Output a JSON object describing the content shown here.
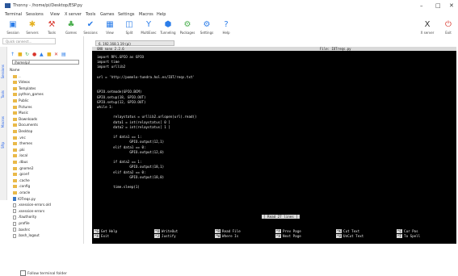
{
  "window": {
    "title": "Thonny - /home/pi/Desktop/ESP.py",
    "title_short": "Thonny"
  },
  "menu": [
    "Terminal",
    "Sessions",
    "View",
    "X server",
    "Tools",
    "Games",
    "Settings",
    "Macros",
    "Help"
  ],
  "toolbar": [
    "Session",
    "Servers",
    "Tools",
    "Games",
    "Sessions",
    "View",
    "Split",
    "MultiExec",
    "Tunneling",
    "Packages",
    "Settings",
    "Help"
  ],
  "toolbar_right": [
    "X server",
    "Exit"
  ],
  "left": {
    "search_placeholder": "Quick connect...",
    "vtabs": [
      "Sessions",
      "Tools",
      "Macros",
      "Sftp"
    ],
    "path": "/home/pi/",
    "tree": [
      {
        "label": "Name",
        "icon": "header"
      },
      {
        "label": "..",
        "icon": "folder"
      },
      {
        "label": "Videos",
        "icon": "folder"
      },
      {
        "label": "Templates",
        "icon": "folder"
      },
      {
        "label": "python_games",
        "icon": "folder"
      },
      {
        "label": "Public",
        "icon": "folder"
      },
      {
        "label": "Pictures",
        "icon": "folder"
      },
      {
        "label": "Music",
        "icon": "folder"
      },
      {
        "label": "Downloads",
        "icon": "folder"
      },
      {
        "label": "Documents",
        "icon": "folder"
      },
      {
        "label": "Desktop",
        "icon": "folder"
      },
      {
        "label": ".vnc",
        "icon": "folder"
      },
      {
        "label": ".themes",
        "icon": "folder"
      },
      {
        "label": ".pki",
        "icon": "folder"
      },
      {
        "label": ".local",
        "icon": "folder"
      },
      {
        "label": ".dbus",
        "icon": "folder"
      },
      {
        "label": ".gnome2",
        "icon": "folder"
      },
      {
        "label": ".gconf",
        "icon": "folder"
      },
      {
        "label": ".cache",
        "icon": "folder"
      },
      {
        "label": ".config",
        "icon": "folder"
      },
      {
        "label": ".oracle",
        "icon": "folder"
      },
      {
        "label": "IOTreqs.py",
        "icon": "python"
      },
      {
        "label": ".xsession-errors.old",
        "icon": "doc"
      },
      {
        "label": ".xsession-errors",
        "icon": "doc"
      },
      {
        "label": ".Xauthority",
        "icon": "doc"
      },
      {
        "label": ".profile",
        "icon": "doc"
      },
      {
        "label": ".bashrc",
        "icon": "doc"
      },
      {
        "label": ".bash_logout",
        "icon": "doc"
      }
    ],
    "follow_label": "Follow terminal folder"
  },
  "tab_label": "6. 192.168.1.19 (pi)",
  "terminal": {
    "header_left": "GNU nano 2.2.6",
    "header_mid": "File: IOTreqs.py",
    "code": [
      "import RPi.GPIO as GPIO",
      "import time",
      "import urllib2",
      "",
      "url = 'http://pomelo-tundra.hol.es/IOT/reqs.txt'",
      "",
      "",
      "GPIO.setmode(GPIO.BCM)",
      "GPIO.setup(18, GPIO.OUT)",
      "GPIO.setup(12, GPIO.OUT)",
      "while 1:",
      "",
      "        relaystatus = urllib2.urlopen(url).read()",
      "        data1 = int(relaystatus[ 0 ]",
      "        data2 = int(relaystatus[ 1 ]",
      "",
      "        if data1 == 1:",
      "                GPIO.output(12,1)",
      "        elif data1 == 0:",
      "                GPIO.output(12,0)",
      "",
      "        if data2 == 1:",
      "                GPIO.output(18,1)",
      "        elif data2 == 0:",
      "                GPIO.output(18,0)",
      "",
      "        time.sleep(1)"
    ],
    "status": "[ Read 27 lines ]",
    "shortcuts": [
      {
        "key": "^G",
        "label": "Get Help"
      },
      {
        "key": "^X",
        "label": "Exit"
      },
      {
        "key": "^O",
        "label": "WriteOut"
      },
      {
        "key": "^J",
        "label": "Justify"
      },
      {
        "key": "^R",
        "label": "Read File"
      },
      {
        "key": "^W",
        "label": "Where Is"
      },
      {
        "key": "^Y",
        "label": "Prev Page"
      },
      {
        "key": "^V",
        "label": "Next Page"
      },
      {
        "key": "^K",
        "label": "Cut Text"
      },
      {
        "key": "^U",
        "label": "UnCut Text"
      },
      {
        "key": "^C",
        "label": "Cur Pos"
      },
      {
        "key": "^T",
        "label": "To Spell"
      }
    ]
  },
  "colors": {
    "terminal_bg": "#000000",
    "terminal_fg": "#e8e8e8",
    "nano_bar": "#d9d9d9",
    "accent": "#2563eb"
  }
}
